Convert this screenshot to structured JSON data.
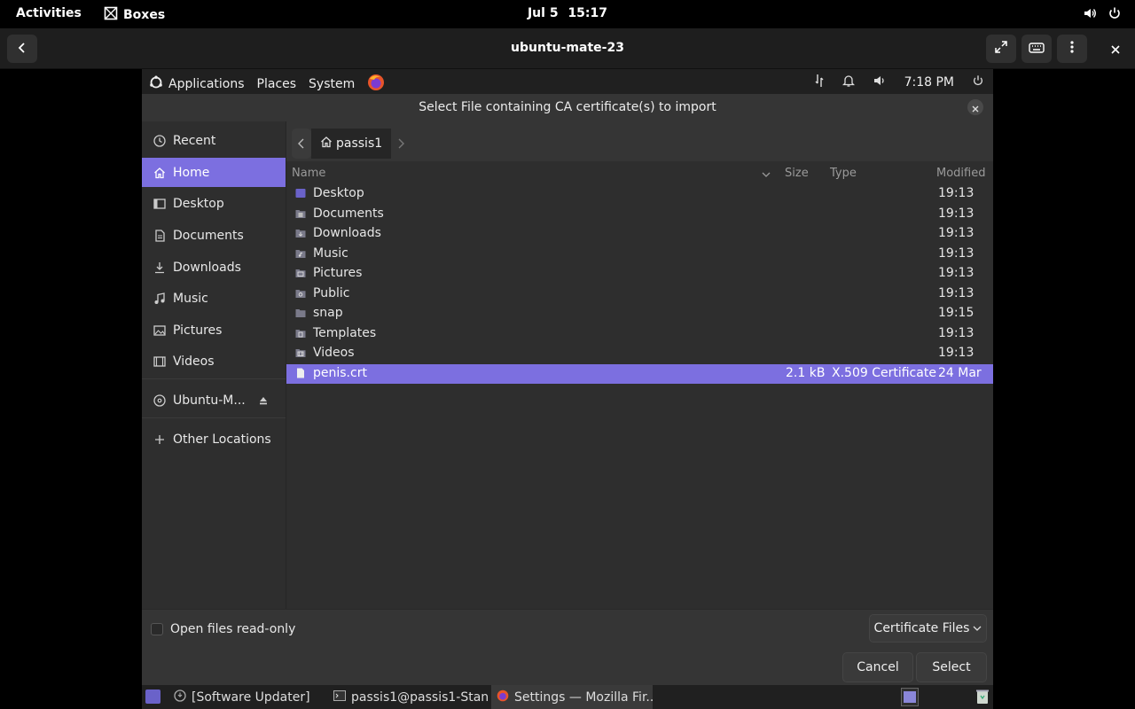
{
  "gnome_topbar": {
    "activities": "Activities",
    "app_name": "Boxes",
    "date": "Jul 5",
    "time": "15:17"
  },
  "boxes_header": {
    "title": "ubuntu-mate-23"
  },
  "mate_panel": {
    "menus": [
      "Applications",
      "Places",
      "System"
    ],
    "clock": "7:18 PM"
  },
  "dialog": {
    "title": "Select File containing CA certificate(s) to import",
    "sidebar": [
      {
        "label": "Recent",
        "icon": "clock-icon"
      },
      {
        "label": "Home",
        "icon": "home-icon"
      },
      {
        "label": "Desktop",
        "icon": "desktop-icon"
      },
      {
        "label": "Documents",
        "icon": "document-icon"
      },
      {
        "label": "Downloads",
        "icon": "download-icon"
      },
      {
        "label": "Music",
        "icon": "music-icon"
      },
      {
        "label": "Pictures",
        "icon": "picture-icon"
      },
      {
        "label": "Videos",
        "icon": "video-icon"
      },
      {
        "label": "Ubuntu-M...",
        "icon": "disc-icon"
      },
      {
        "label": "Other Locations",
        "icon": "plus-icon"
      }
    ],
    "path": "passis1",
    "columns": {
      "name": "Name",
      "size": "Size",
      "type": "Type",
      "modified": "Modified"
    },
    "files": [
      {
        "name": "Desktop",
        "size": "",
        "type": "",
        "modified": "19:13"
      },
      {
        "name": "Documents",
        "size": "",
        "type": "",
        "modified": "19:13"
      },
      {
        "name": "Downloads",
        "size": "",
        "type": "",
        "modified": "19:13"
      },
      {
        "name": "Music",
        "size": "",
        "type": "",
        "modified": "19:13"
      },
      {
        "name": "Pictures",
        "size": "",
        "type": "",
        "modified": "19:13"
      },
      {
        "name": "Public",
        "size": "",
        "type": "",
        "modified": "19:13"
      },
      {
        "name": "snap",
        "size": "",
        "type": "",
        "modified": "19:15"
      },
      {
        "name": "Templates",
        "size": "",
        "type": "",
        "modified": "19:13"
      },
      {
        "name": "Videos",
        "size": "",
        "type": "",
        "modified": "19:13"
      },
      {
        "name": "penis.crt",
        "size": "2.1 kB",
        "type": "X.509 Certificate",
        "modified": "24 Mar"
      }
    ],
    "readonly_label": "Open files read-only",
    "filter": "Certificate Files",
    "cancel": "Cancel",
    "select": "Select"
  },
  "taskbar": {
    "tasks": [
      "[Software Updater]",
      "passis1@passis1-Stan...",
      "Settings — Mozilla Fir..."
    ]
  },
  "colors": {
    "accent": "#7c6fe0",
    "background": "#2e2e2e"
  }
}
